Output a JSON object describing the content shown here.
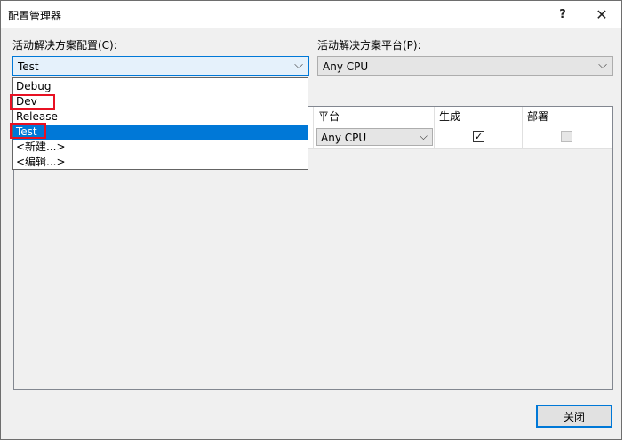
{
  "window": {
    "title": "配置管理器",
    "help_glyph": "?",
    "close_glyph": "✕"
  },
  "config": {
    "label": "活动解决方案配置(C):",
    "selected": "Test",
    "chevron": "⌵",
    "options": [
      "Debug",
      "Dev",
      "Release",
      "Test",
      "<新建...>",
      "<编辑...>"
    ],
    "highlighted_option": "Test",
    "marked_options": [
      "Dev",
      "Test"
    ],
    "marker_color": "#e81123"
  },
  "platform": {
    "label": "活动解决方案平台(P):",
    "selected": "Any CPU",
    "chevron": "⌵"
  },
  "grid": {
    "headers": {
      "platform": "平台",
      "build": "生成",
      "deploy": "部署"
    },
    "rows": [
      {
        "platform": "Any CPU",
        "chevron": "⌵",
        "build": true,
        "deploy": false,
        "build_glyph": "✓"
      }
    ]
  },
  "footer": {
    "close_label": "关闭"
  },
  "colors": {
    "accent": "#0078d7",
    "dialog_bg": "#f0f0f0"
  }
}
